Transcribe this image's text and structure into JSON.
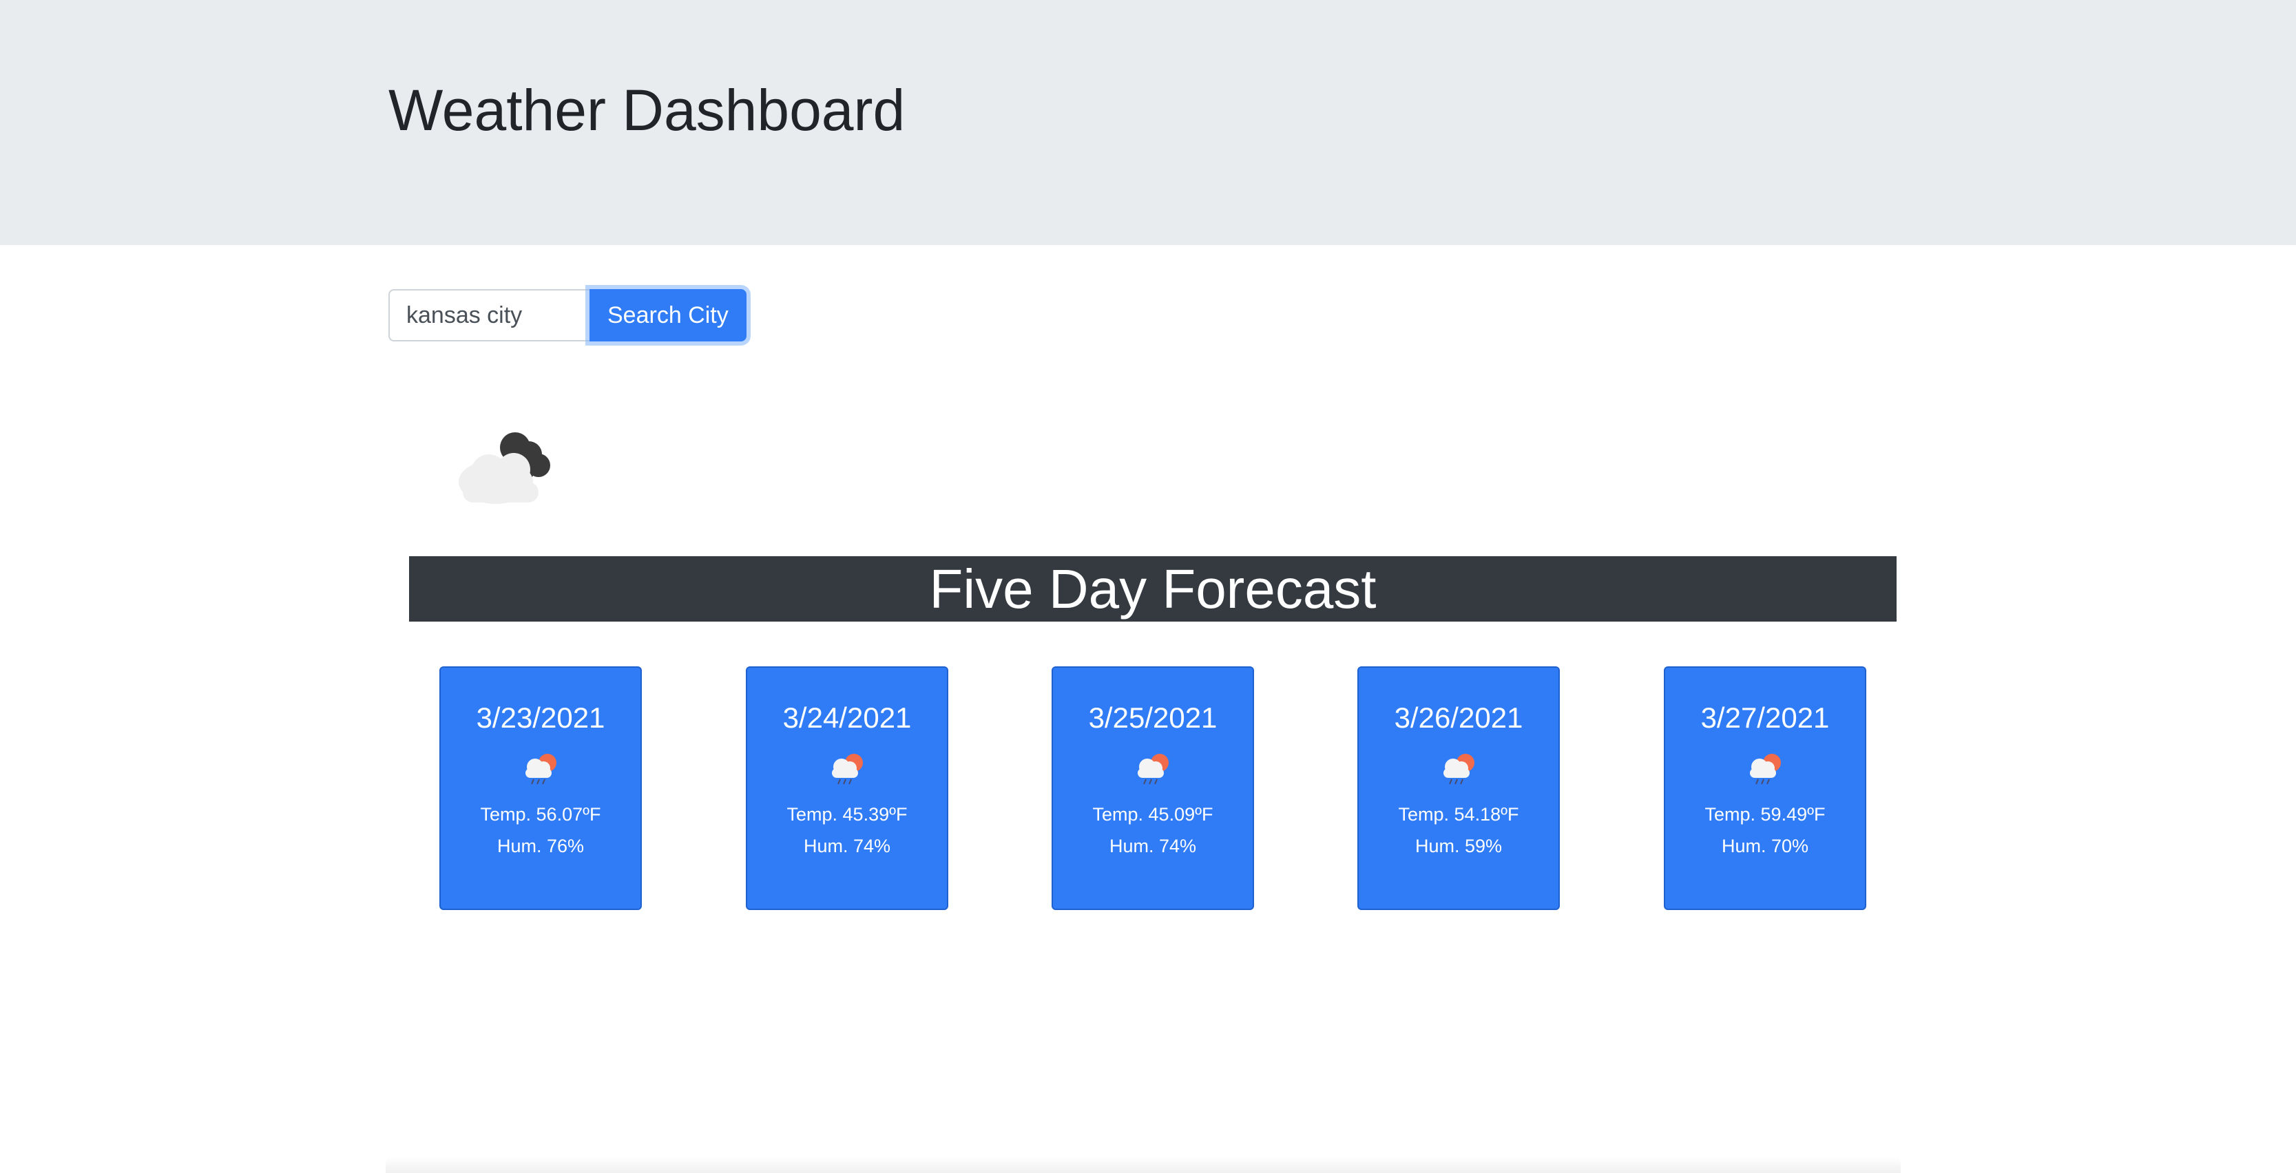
{
  "header": {
    "title": "Weather Dashboard"
  },
  "search": {
    "value": "kansas city",
    "button_label": "Search City"
  },
  "current": {
    "icon": "cloudy-night-icon"
  },
  "forecast": {
    "heading": "Five Day Forecast",
    "days": [
      {
        "date": "3/23/2021",
        "icon": "rain-sun-icon",
        "temp": "Temp. 56.07ºF",
        "hum": "Hum. 76%"
      },
      {
        "date": "3/24/2021",
        "icon": "rain-sun-icon",
        "temp": "Temp. 45.39ºF",
        "hum": "Hum. 74%"
      },
      {
        "date": "3/25/2021",
        "icon": "rain-sun-icon",
        "temp": "Temp. 45.09ºF",
        "hum": "Hum. 74%"
      },
      {
        "date": "3/26/2021",
        "icon": "rain-sun-icon",
        "temp": "Temp. 54.18ºF",
        "hum": "Hum. 59%"
      },
      {
        "date": "3/27/2021",
        "icon": "rain-sun-icon",
        "temp": "Temp. 59.49ºF",
        "hum": "Hum. 70%"
      }
    ]
  },
  "colors": {
    "accent": "#2f7cf6",
    "header_bg": "#e9ecef",
    "forecast_bar": "#343a40"
  }
}
